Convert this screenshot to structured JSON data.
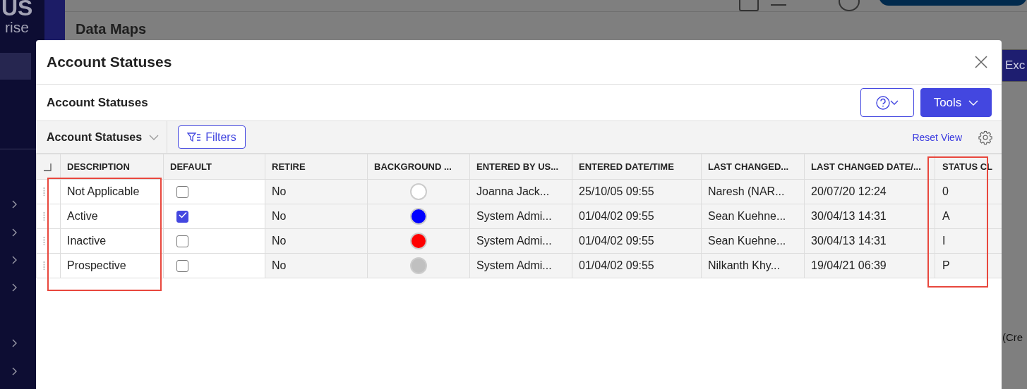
{
  "app": {
    "logo_lines": [
      "US",
      "rise"
    ],
    "page_title": "Data Maps",
    "export_button": "Exc",
    "side_text": "(Cre"
  },
  "modal": {
    "title": "Account Statuses",
    "section_title": "Account Statuses",
    "tools_button": "Tools",
    "view_select": "Account Statuses",
    "filters_button": "Filters",
    "reset_view": "Reset View"
  },
  "table": {
    "columns": [
      {
        "label": "DESCRIPTION",
        "kind": "text"
      },
      {
        "label": "DEFAULT",
        "kind": "checkbox"
      },
      {
        "label": "RETIRE",
        "kind": "text"
      },
      {
        "label": "BACKGROUND ...",
        "kind": "color"
      },
      {
        "label": "ENTERED BY US...",
        "kind": "text"
      },
      {
        "label": "ENTERED DATE/TIME",
        "kind": "text"
      },
      {
        "label": "LAST CHANGED...",
        "kind": "text"
      },
      {
        "label": "LAST CHANGED DATE/...",
        "kind": "text"
      },
      {
        "label": "STATUS CL",
        "kind": "text"
      }
    ],
    "rows": [
      {
        "cells": [
          "Not Applicable",
          {
            "checked": false
          },
          "No",
          {
            "color": "#ffffff"
          },
          "Joanna Jack...",
          "25/10/05 09:55",
          "Naresh (NAR...",
          "20/07/20 12:24",
          "0"
        ]
      },
      {
        "cells": [
          "Active",
          {
            "checked": true
          },
          "No",
          {
            "color": "#0000ff"
          },
          "System Admi...",
          "01/04/02 09:55",
          "Sean Kuehne...",
          "30/04/13 14:31",
          "A"
        ]
      },
      {
        "cells": [
          "Inactive",
          {
            "checked": false
          },
          "No",
          {
            "color": "#ff0000"
          },
          "System Admi...",
          "01/04/02 09:55",
          "Sean Kuehne...",
          "30/04/13 14:31",
          "I"
        ]
      },
      {
        "cells": [
          "Prospective",
          {
            "checked": false
          },
          "No",
          {
            "color": "#c0c0c0"
          },
          "System Admi...",
          "01/04/02 09:55",
          "Nilkanth Khy...",
          "19/04/21 06:39",
          "P"
        ]
      }
    ]
  }
}
